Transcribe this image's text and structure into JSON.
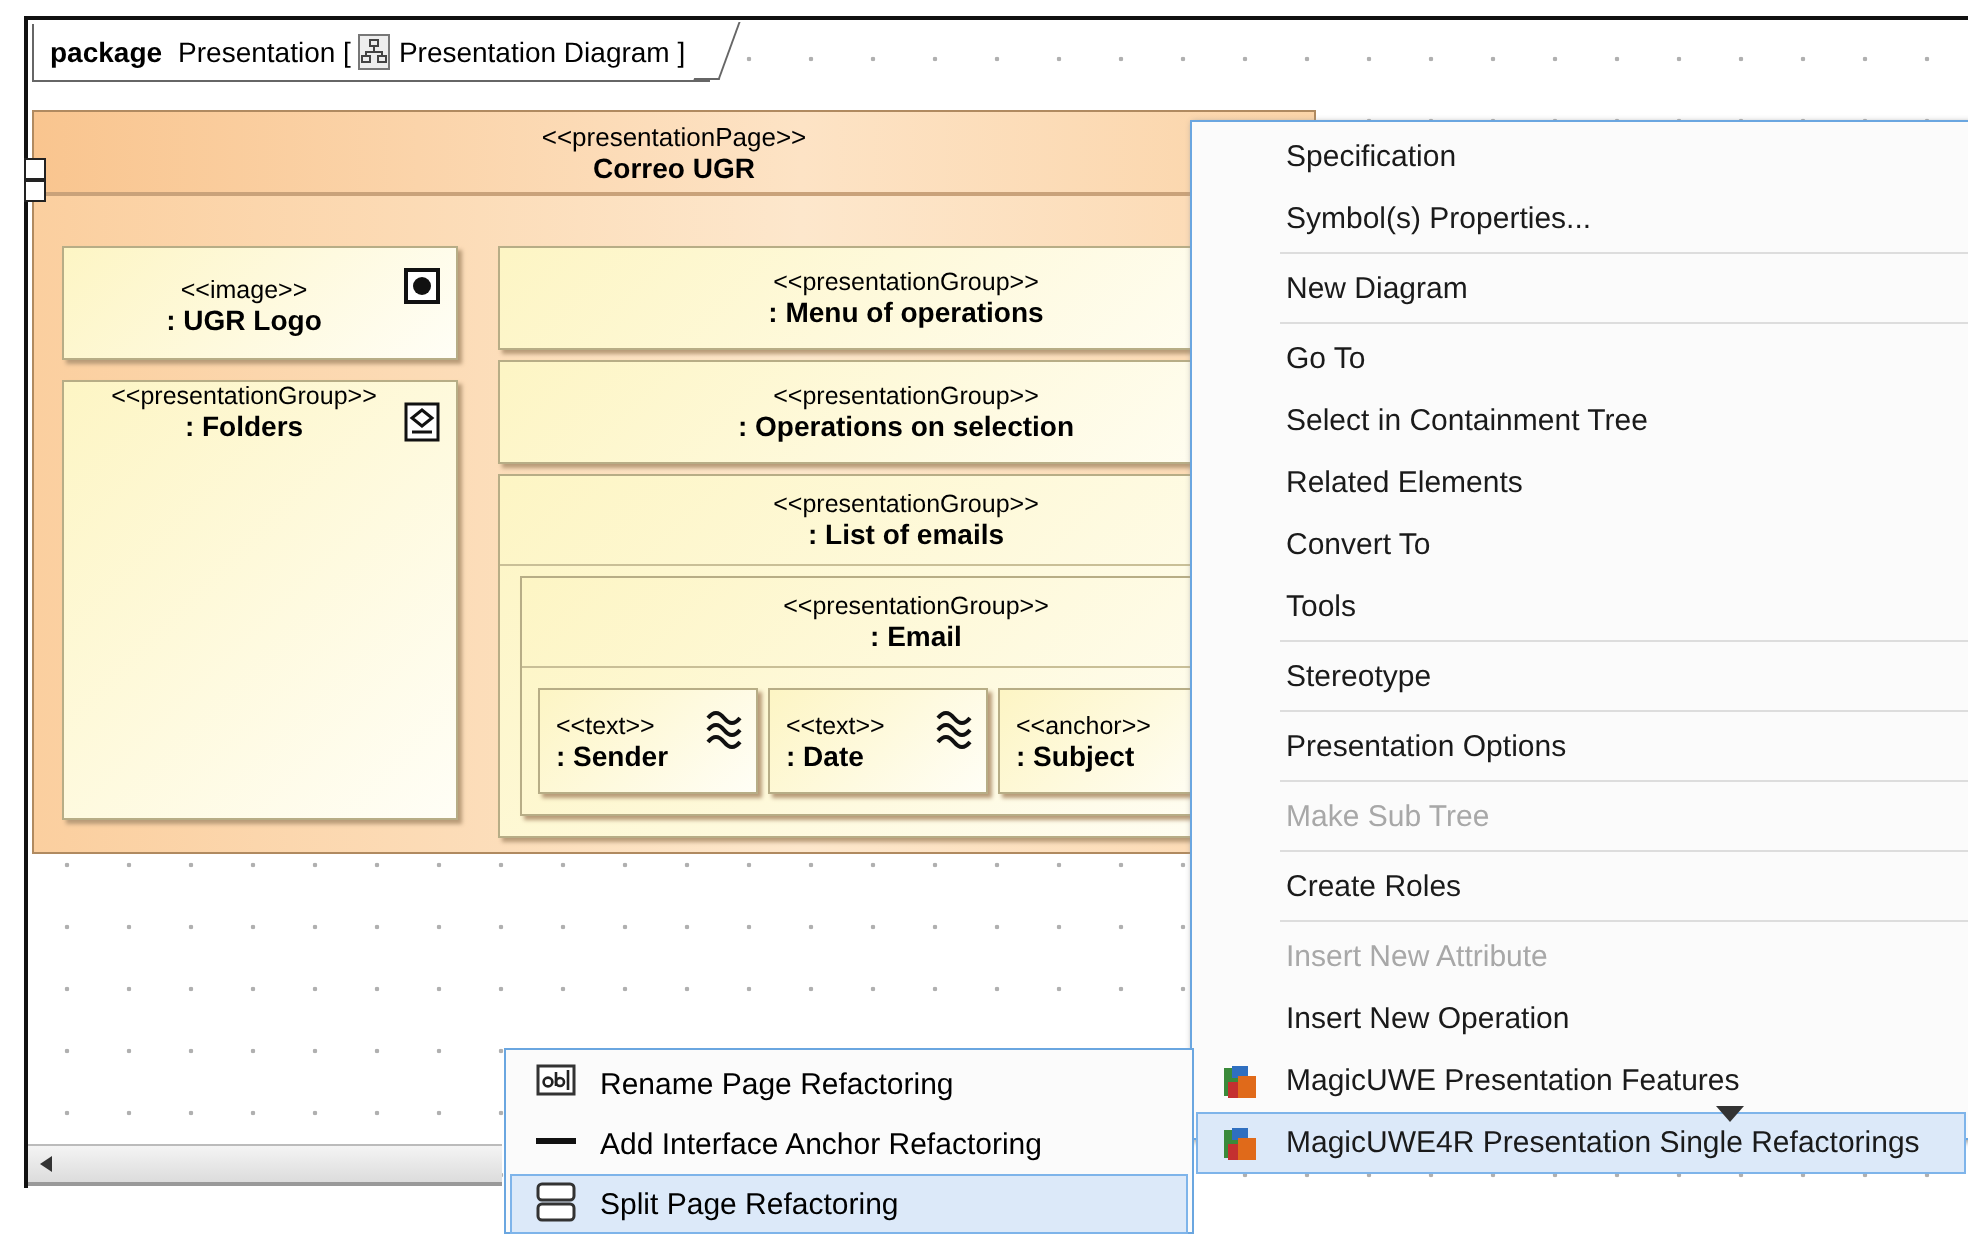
{
  "diagram": {
    "keyword": "package",
    "name": "Presentation [",
    "diagram_name": "Presentation Diagram ]"
  },
  "page": {
    "stereotype": "<<presentationPage>>",
    "name": "Correo UGR",
    "left": [
      {
        "stereotype": "<<image>>",
        "name": ": UGR Logo",
        "kind": "image"
      },
      {
        "stereotype": "<<presentationGroup>>",
        "name": ": Folders",
        "kind": "group"
      }
    ],
    "groups": [
      {
        "stereotype": "<<presentationGroup>>",
        "name": ": Menu of operations"
      },
      {
        "stereotype": "<<presentationGroup>>",
        "name": ": Operations on selection"
      },
      {
        "stereotype": "<<presentationGroup>>",
        "name": ": List of emails",
        "children": [
          {
            "stereotype": "<<presentationGroup>>",
            "name": ": Email",
            "children": [
              {
                "stereotype": "<<text>>",
                "name": ": Sender",
                "kind": "text"
              },
              {
                "stereotype": "<<text>>",
                "name": ": Date",
                "kind": "text"
              },
              {
                "stereotype": "<<anchor>>",
                "name": ": Subject",
                "kind": "anchor"
              }
            ]
          }
        ]
      }
    ]
  },
  "context_menu": {
    "items": [
      {
        "label": "Specification",
        "disabled": false,
        "selected": false,
        "separator_after": false
      },
      {
        "label": "Symbol(s) Properties...",
        "disabled": false,
        "selected": false,
        "separator_after": true
      },
      {
        "label": "New Diagram",
        "disabled": false,
        "selected": false,
        "separator_after": true
      },
      {
        "label": "Go To",
        "disabled": false,
        "selected": false,
        "separator_after": false
      },
      {
        "label": "Select in Containment Tree",
        "disabled": false,
        "selected": false,
        "separator_after": false
      },
      {
        "label": "Related Elements",
        "disabled": false,
        "selected": false,
        "separator_after": false
      },
      {
        "label": "Convert To",
        "disabled": false,
        "selected": false,
        "separator_after": false
      },
      {
        "label": "Tools",
        "disabled": false,
        "selected": false,
        "separator_after": true
      },
      {
        "label": "Stereotype",
        "disabled": false,
        "selected": false,
        "separator_after": true
      },
      {
        "label": "Presentation Options",
        "disabled": false,
        "selected": false,
        "separator_after": true
      },
      {
        "label": "Make Sub Tree",
        "disabled": true,
        "selected": false,
        "separator_after": true
      },
      {
        "label": "Create Roles",
        "disabled": false,
        "selected": false,
        "separator_after": true
      },
      {
        "label": "Insert New Attribute",
        "disabled": true,
        "selected": false,
        "separator_after": false
      },
      {
        "label": "Insert New Operation",
        "disabled": false,
        "selected": false,
        "separator_after": false
      },
      {
        "label": "MagicUWE Presentation Features",
        "disabled": false,
        "selected": false,
        "separator_after": false,
        "kind": "uwe"
      },
      {
        "label": "MagicUWE4R Presentation Single Refactorings",
        "disabled": false,
        "selected": true,
        "separator_after": false,
        "kind": "uwe"
      }
    ]
  },
  "submenu": {
    "items": [
      {
        "label": "Rename Page Refactoring",
        "kind": "textfield",
        "selected": false
      },
      {
        "label": "Add Interface Anchor Refactoring",
        "kind": "line",
        "selected": false
      },
      {
        "label": "Split Page Refactoring",
        "kind": "split",
        "selected": true
      }
    ]
  }
}
